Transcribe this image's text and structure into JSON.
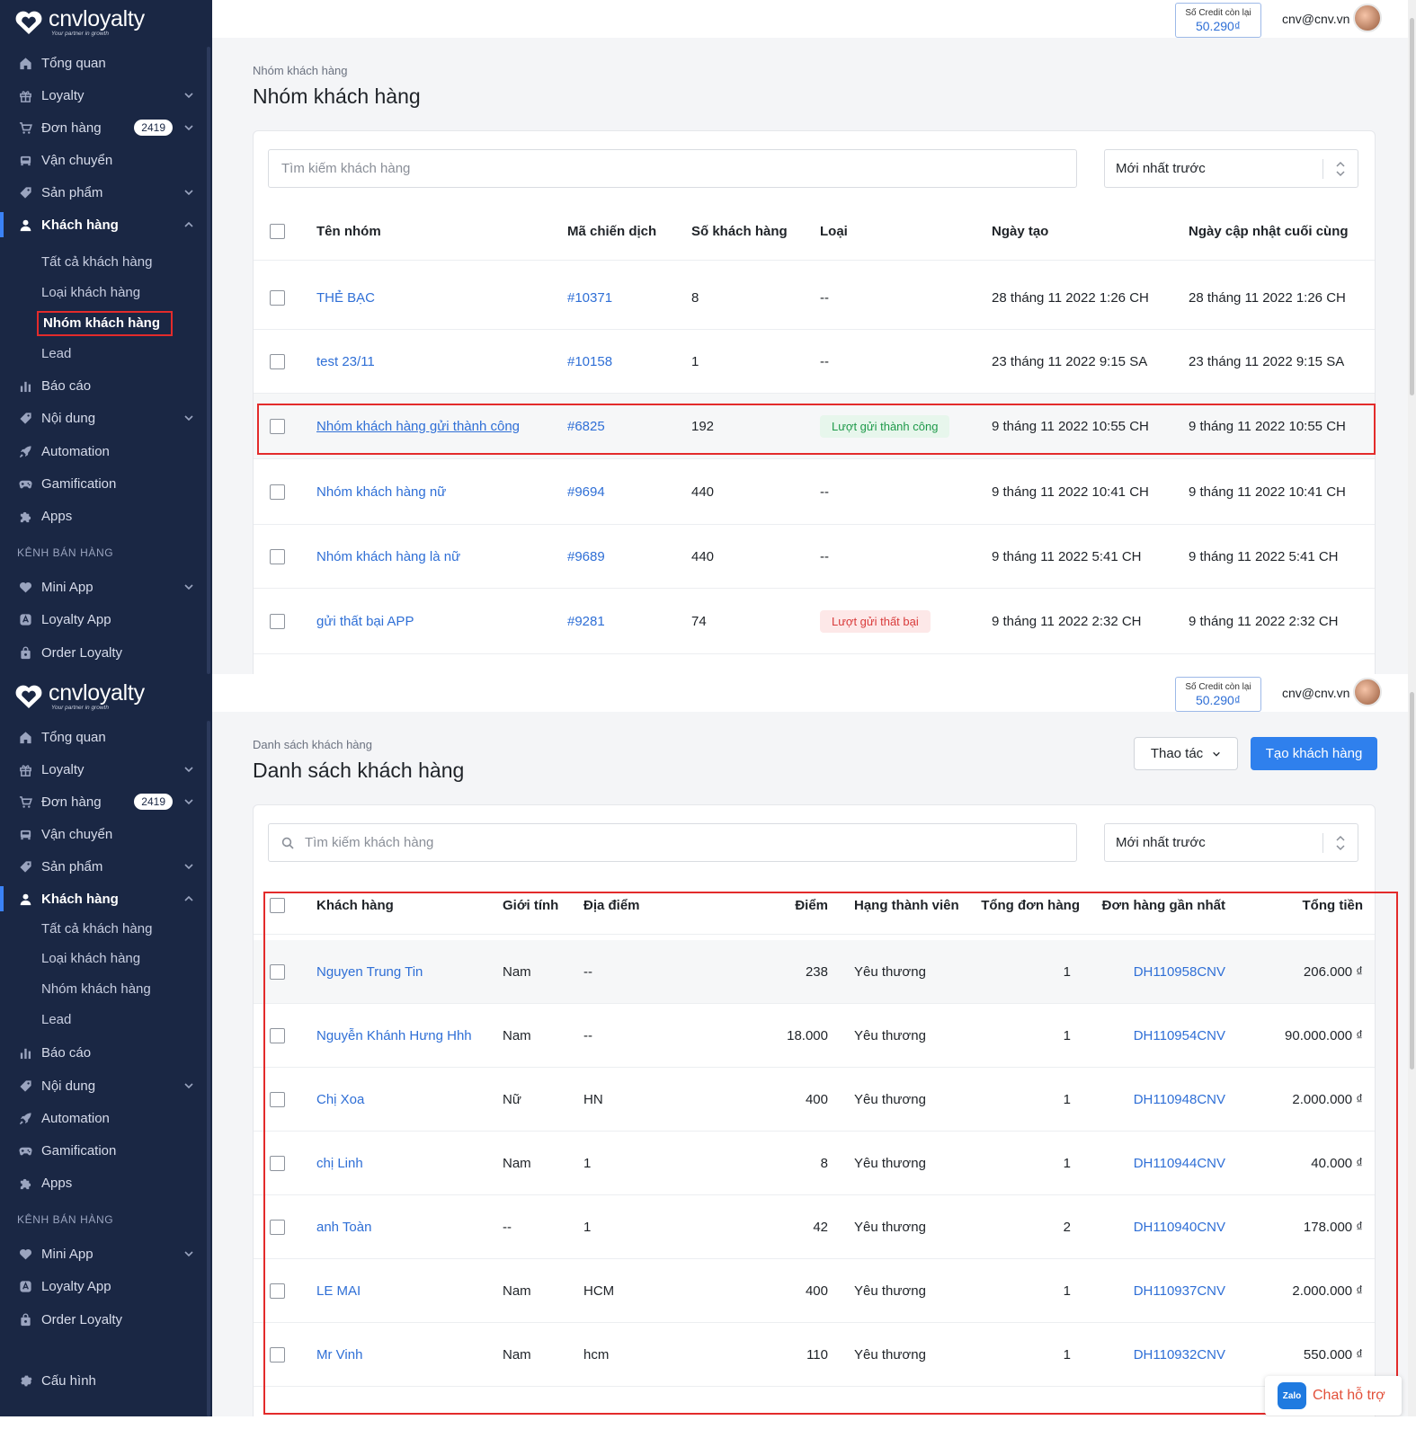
{
  "brand": {
    "name": "cnvloyalty",
    "tagline": "Your partner in growth"
  },
  "topbar": {
    "credit_label": "Số Credit còn lại",
    "credit_value": "50.290₫",
    "email": "cnv@cnv.vn"
  },
  "sidebar": {
    "items": [
      {
        "label": "Tổng quan",
        "icon": "home-icon"
      },
      {
        "label": "Loyalty",
        "icon": "gift-icon",
        "expandable": true
      },
      {
        "label": "Đơn hàng",
        "icon": "cart-icon",
        "badge": "2419",
        "expandable": true
      },
      {
        "label": "Vận chuyển",
        "icon": "truck-icon"
      },
      {
        "label": "Sản phẩm",
        "icon": "tag-icon",
        "expandable": true
      },
      {
        "label": "Khách hàng",
        "icon": "user-icon",
        "expanded": true,
        "active": true
      },
      {
        "label": "Báo cáo",
        "icon": "bar-chart-icon"
      },
      {
        "label": "Nội dung",
        "icon": "tag-icon",
        "expandable": true
      },
      {
        "label": "Automation",
        "icon": "rocket-icon"
      },
      {
        "label": "Gamification",
        "icon": "gamepad-icon"
      },
      {
        "label": "Apps",
        "icon": "puzzle-icon"
      }
    ],
    "sub_items": [
      "Tất cả khách hàng",
      "Loại khách hàng",
      "Nhóm khách hàng",
      "Lead"
    ],
    "section_label": "KÊNH BÁN HÀNG",
    "channel_items": [
      {
        "label": "Mini App",
        "icon": "heart-icon",
        "expandable": true
      },
      {
        "label": "Loyalty App",
        "icon": "app-icon"
      },
      {
        "label": "Order Loyalty",
        "icon": "bag-icon"
      }
    ],
    "settings_label": "Cấu hình"
  },
  "screen1": {
    "breadcrumb": "Nhóm khách hàng",
    "title": "Nhóm khách hàng",
    "search_placeholder": "Tìm kiếm khách hàng",
    "sort_value": "Mới nhất trước",
    "columns": [
      "Tên nhóm",
      "Mã chiến dịch",
      "Số khách hàng",
      "Loại",
      "Ngày tạo",
      "Ngày cập nhật cuối cùng"
    ],
    "rows": [
      {
        "name": "THẺ BẠC",
        "campaign": "#10371",
        "count": "8",
        "type": "--",
        "created": "28 tháng 11 2022 1:26 CH",
        "updated": "28 tháng 11 2022 1:26 CH"
      },
      {
        "name": "test 23/11",
        "campaign": "#10158",
        "count": "1",
        "type": "--",
        "created": "23 tháng 11 2022 9:15 SA",
        "updated": "23 tháng 11 2022 9:15 SA"
      },
      {
        "name": "Nhóm khách hàng gửi thành công",
        "campaign": "#6825",
        "count": "192",
        "type": "Lượt gửi thành công",
        "created": "9 tháng 11 2022 10:55 CH",
        "updated": "9 tháng 11 2022 10:55 CH"
      },
      {
        "name": "Nhóm khách hàng nữ",
        "campaign": "#9694",
        "count": "440",
        "type": "--",
        "created": "9 tháng 11 2022 10:41 CH",
        "updated": "9 tháng 11 2022 10:41 CH"
      },
      {
        "name": "Nhóm khách hàng là nữ",
        "campaign": "#9689",
        "count": "440",
        "type": "--",
        "created": "9 tháng 11 2022 5:41 CH",
        "updated": "9 tháng 11 2022 5:41 CH"
      },
      {
        "name": "gửi thất bại APP",
        "campaign": "#9281",
        "count": "74",
        "type": "Lượt gửi thất bại",
        "created": "9 tháng 11 2022 2:32 CH",
        "updated": "9 tháng 11 2022 2:32 CH"
      }
    ]
  },
  "screen2": {
    "breadcrumb": "Danh sách khách hàng",
    "title": "Danh sách khách hàng",
    "actions_label": "Thao tác",
    "create_label": "Tạo khách hàng",
    "search_placeholder": "Tìm kiếm khách hàng",
    "sort_value": "Mới nhất trước",
    "columns": [
      "Khách hàng",
      "Giới tính",
      "Địa điểm",
      "Điểm",
      "Hạng thành viên",
      "Tổng đơn hàng",
      "Đơn hàng gần nhất",
      "Tổng tiền"
    ],
    "rows": [
      {
        "name": "Nguyen Trung Tin",
        "gender": "Nam",
        "location": "--",
        "points": "238",
        "tier": "Yêu thương",
        "orders": "1",
        "last_order": "DH110958CNV",
        "total": "206.000 ₫"
      },
      {
        "name": "Nguyễn Khánh Hưng Hhh",
        "gender": "Nam",
        "location": "--",
        "points": "18.000",
        "tier": "Yêu thương",
        "orders": "1",
        "last_order": "DH110954CNV",
        "total": "90.000.000 ₫"
      },
      {
        "name": "Chị Xoa",
        "gender": "Nữ",
        "location": "HN",
        "points": "400",
        "tier": "Yêu thương",
        "orders": "1",
        "last_order": "DH110948CNV",
        "total": "2.000.000 ₫"
      },
      {
        "name": "chị Linh",
        "gender": "Nam",
        "location": "1",
        "points": "8",
        "tier": "Yêu thương",
        "orders": "1",
        "last_order": "DH110944CNV",
        "total": "40.000 ₫"
      },
      {
        "name": "anh Toàn",
        "gender": "--",
        "location": "1",
        "points": "42",
        "tier": "Yêu thương",
        "orders": "2",
        "last_order": "DH110940CNV",
        "total": "178.000 ₫"
      },
      {
        "name": "LE MAI",
        "gender": "Nam",
        "location": "HCM",
        "points": "400",
        "tier": "Yêu thương",
        "orders": "1",
        "last_order": "DH110937CNV",
        "total": "2.000.000 ₫"
      },
      {
        "name": "Mr Vinh",
        "gender": "Nam",
        "location": "hcm",
        "points": "110",
        "tier": "Yêu thương",
        "orders": "1",
        "last_order": "DH110932CNV",
        "total": "550.000 ₫"
      }
    ],
    "chat_label": "Chat hỗ trợ",
    "chat_icon_text": "Zalo"
  },
  "colors": {
    "sidebar_bg": "#1a2744",
    "link": "#2f6fd6",
    "primary": "#2f80ed",
    "highlight_box": "#e32b2b",
    "success": "#1f9a4a",
    "danger": "#d93b3b"
  }
}
